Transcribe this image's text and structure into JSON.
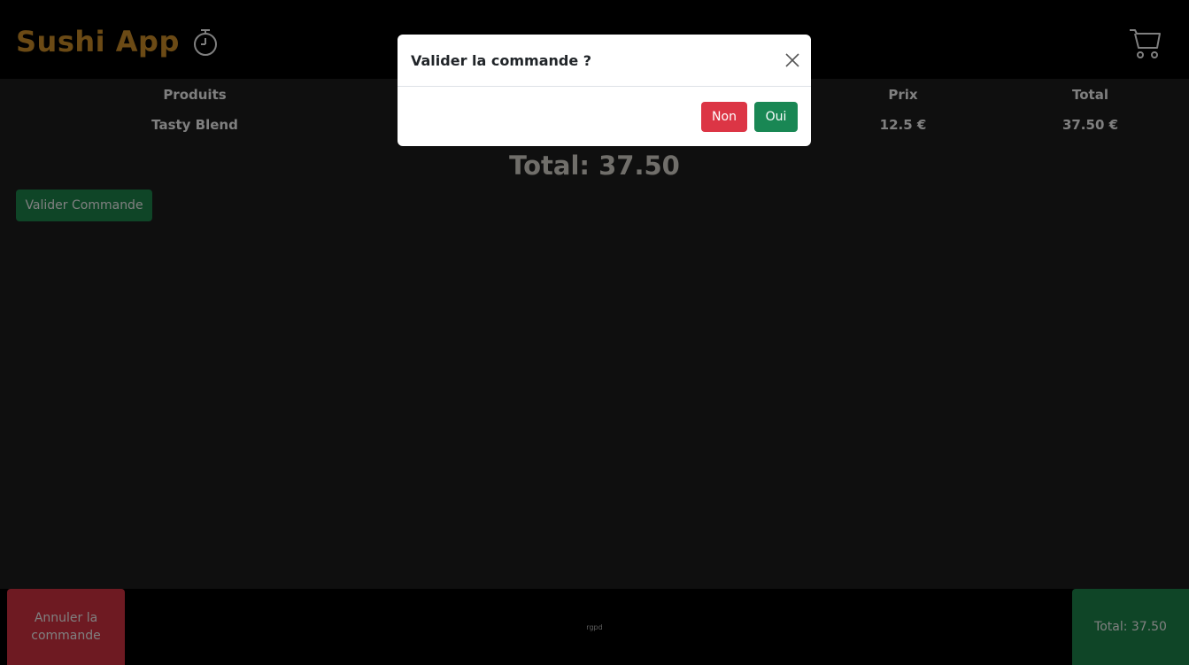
{
  "app": {
    "title": "Sushi App"
  },
  "icons": {
    "timer": "stopwatch-icon",
    "cart": "cart-icon",
    "close": "close-icon"
  },
  "table": {
    "headers": [
      "Produits",
      "",
      "Prix",
      "Total"
    ],
    "rows": [
      [
        "Tasty Blend",
        "",
        "12.5 €",
        "37.50 €"
      ]
    ]
  },
  "summary": {
    "total_label": "Total: 37.50"
  },
  "actions": {
    "validate_label": "Valider Commande",
    "cancel_label": "Annuler la commande",
    "total_button_label": "Total: 37.50"
  },
  "footer": {
    "rgpd": "rgpd"
  },
  "dialog": {
    "title": "Valider la commande ?",
    "no_label": "Non",
    "yes_label": "Oui"
  },
  "colors": {
    "brand": "#d6942b",
    "success": "#198754",
    "danger": "#dc3545",
    "topbar": "#000000",
    "background": "#1e1e1e"
  }
}
